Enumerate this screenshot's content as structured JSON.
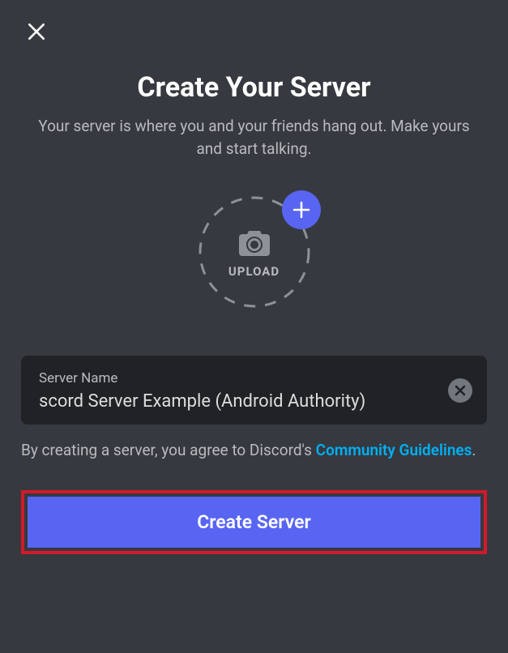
{
  "header": {
    "title": "Create Your Server",
    "subtitle": "Your server is where you and your friends hang out. Make yours and start talking."
  },
  "upload": {
    "label": "UPLOAD"
  },
  "form": {
    "server_name_label": "Server Name",
    "server_name_value": "scord Server Example (Android Authority)"
  },
  "agreement": {
    "prefix": "By creating a server, you agree to Discord's ",
    "link_text": "Community Guidelines",
    "suffix": "."
  },
  "cta": {
    "label": "Create Server"
  }
}
